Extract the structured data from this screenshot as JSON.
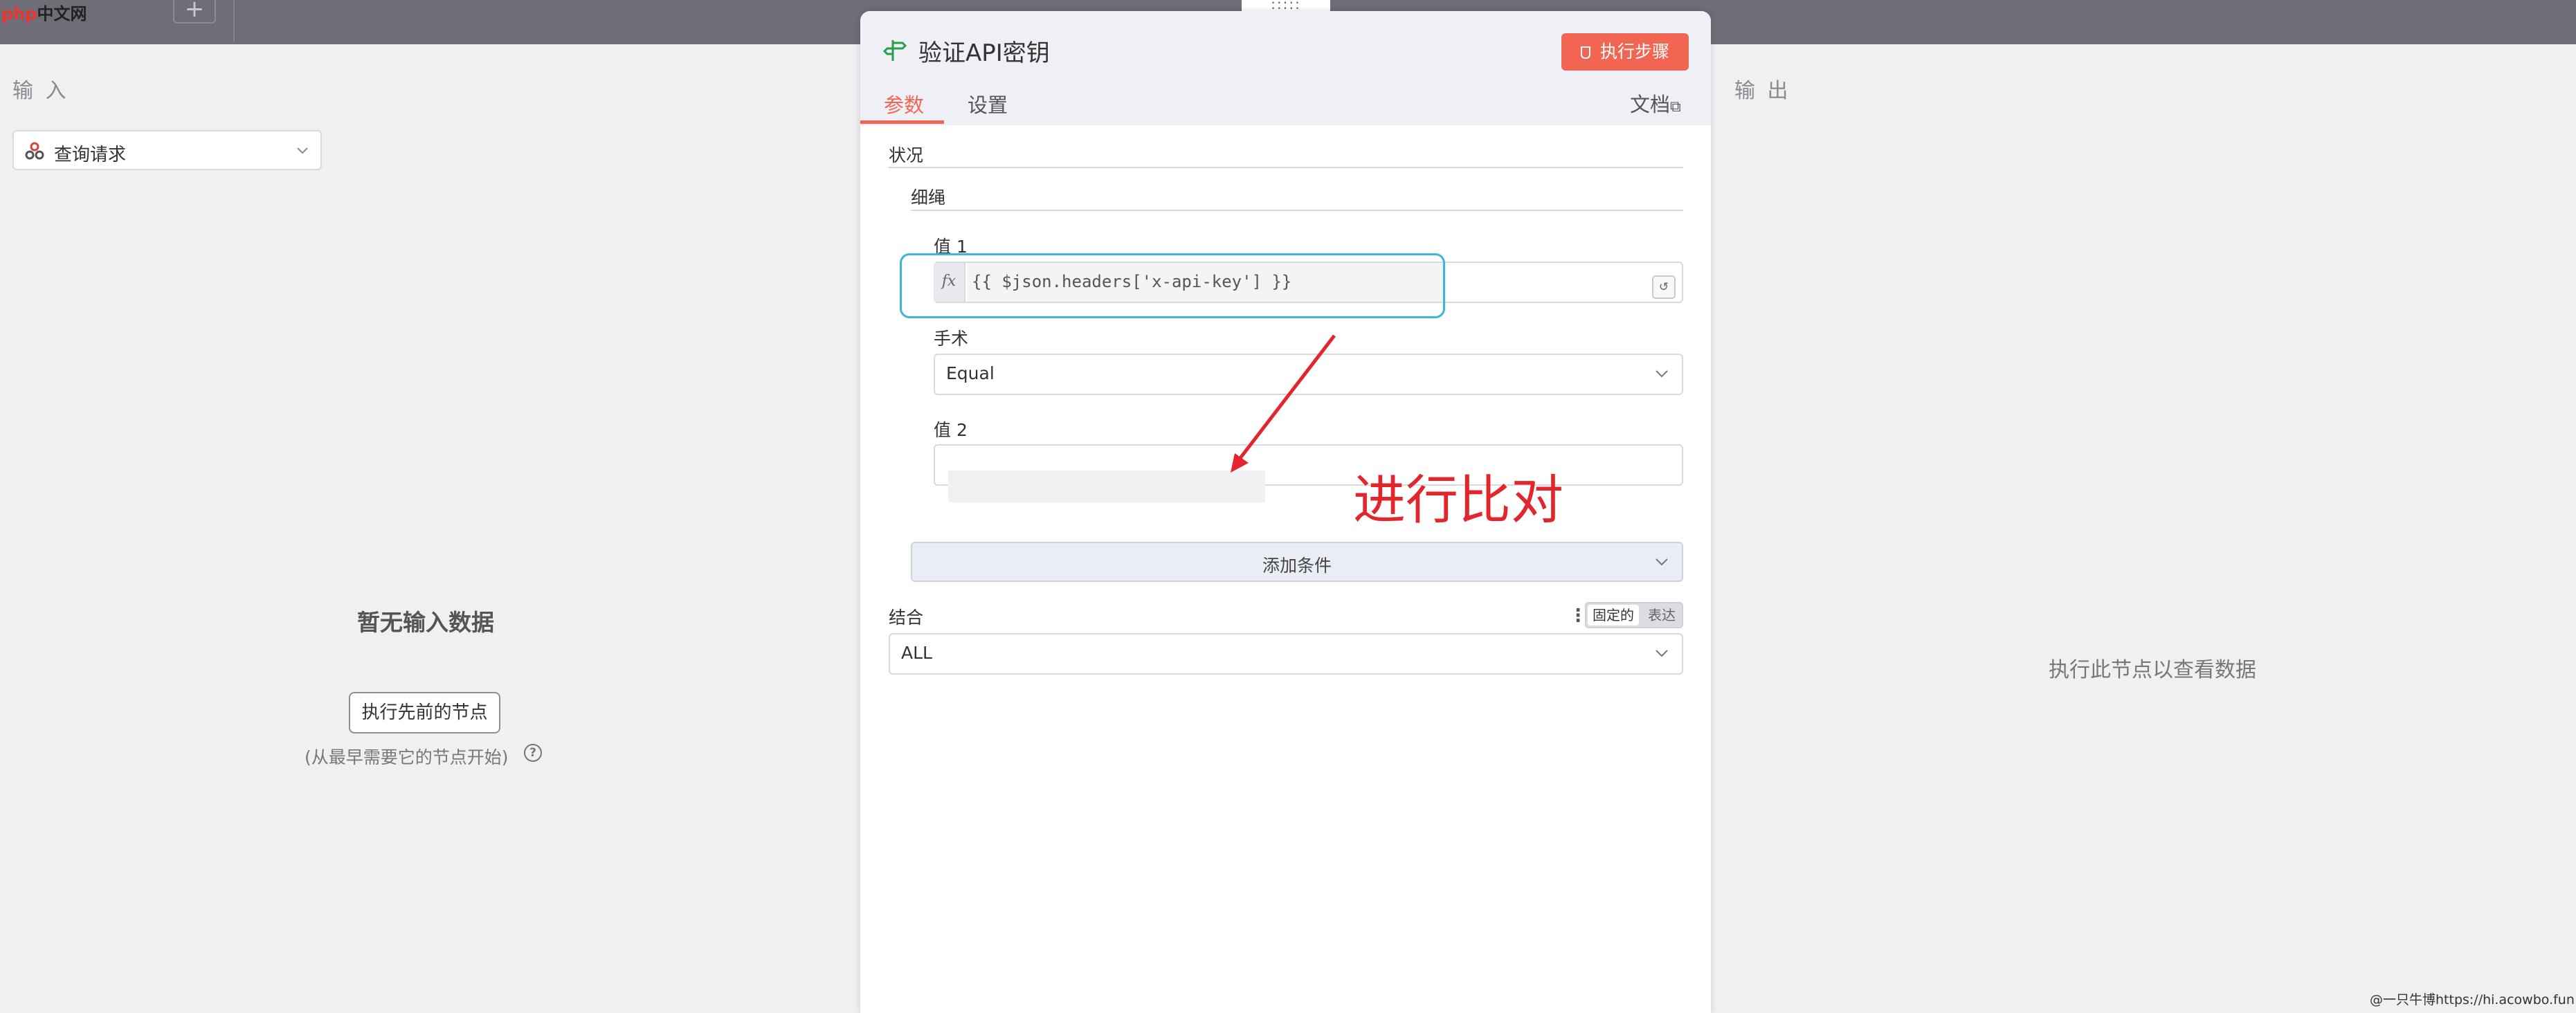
{
  "topbar": {
    "logo_text": "php",
    "logo_suffix": "中文网",
    "add_tab_icon": "+"
  },
  "input_panel": {
    "heading": "输 入",
    "selected_node": "查询请求",
    "empty_title": "暂无输入数据",
    "run_prev_button": "执行先前的节点",
    "hint": "(从最早需要它的节点开始)",
    "help_icon": "?"
  },
  "output_panel": {
    "heading": "输 出",
    "empty_text": "执行此节点以查看数据"
  },
  "dialog": {
    "drag_handle": ":::::",
    "title": "验证API密钥",
    "exec_button": "执行步骤",
    "tabs": [
      {
        "label": "参数",
        "active": true
      },
      {
        "label": "设置",
        "active": false
      }
    ],
    "docs_link": "文档",
    "docs_ext_icon": "⧉",
    "conditions_label": "状况",
    "string_label": "细绳",
    "value1_label": "值 1",
    "value1_fx": "fx",
    "value1_expression": "{{ $json.headers['x-api-key'] }}",
    "map_icon": "↺",
    "operation_label": "手术",
    "operation_value": "Equal",
    "value2_label": "值 2",
    "value2_value": "",
    "add_condition": "添加条件",
    "combine_label": "结合",
    "combine_mode_on": "固定的",
    "combine_mode_off": "表达",
    "kebab_icon": "⋮",
    "combine_value": "ALL"
  },
  "annotation": {
    "text": "进行比对",
    "color": "#e3262b"
  },
  "watermark": "@一只牛博https://hi.acowbo.fun",
  "colors": {
    "accent": "#f26552",
    "highlight": "#3ab7d9",
    "node_icon": "#2a9d4a"
  }
}
